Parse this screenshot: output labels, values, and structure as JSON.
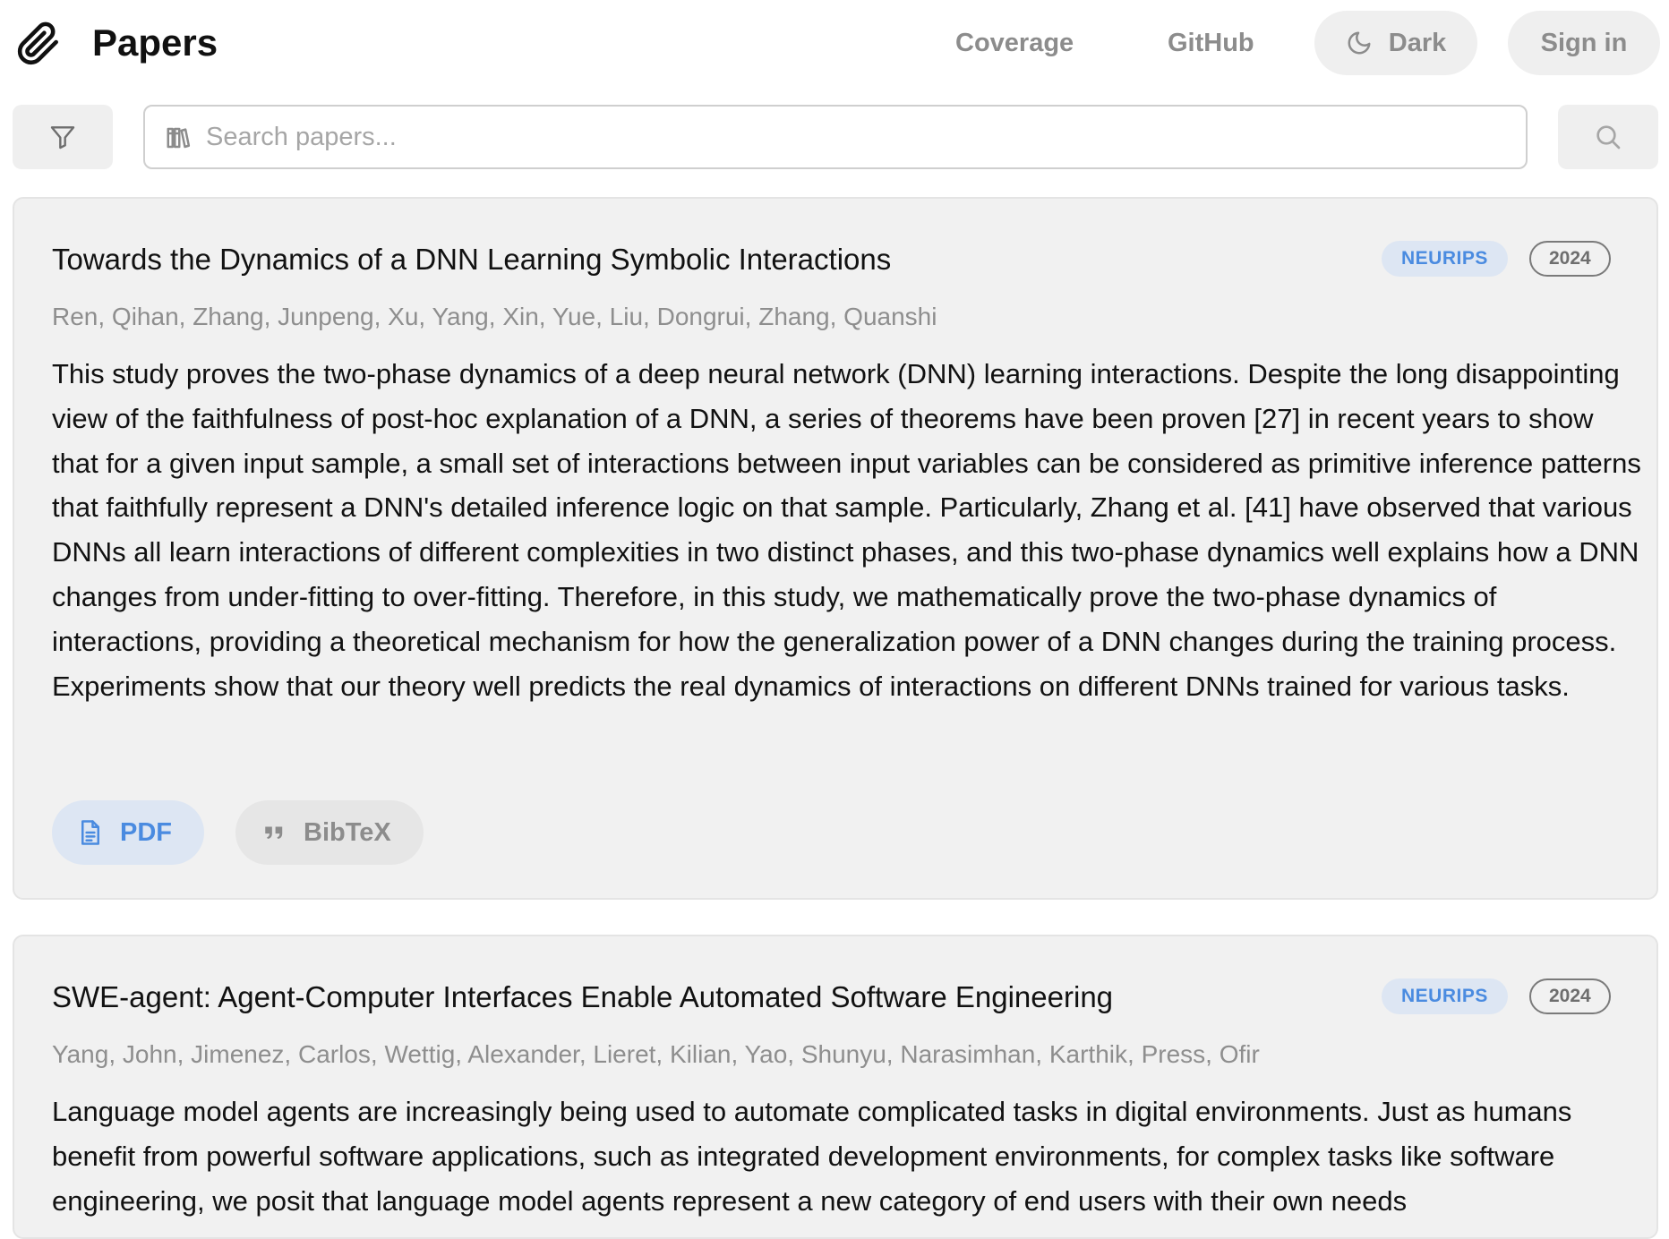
{
  "header": {
    "brand": "Papers",
    "logo_icon": "paperclip-icon",
    "nav": {
      "coverage": "Coverage",
      "github": "GitHub",
      "dark": "Dark",
      "sign_in": "Sign in"
    }
  },
  "search": {
    "placeholder": "Search papers...",
    "value": ""
  },
  "papers": [
    {
      "title": "Towards the Dynamics of a DNN Learning Symbolic Interactions",
      "venue": "NEURIPS",
      "year": "2024",
      "authors": "Ren, Qihan, Zhang, Junpeng, Xu, Yang, Xin, Yue, Liu, Dongrui, Zhang, Quanshi",
      "abstract": "This study proves the two-phase dynamics of a deep neural network (DNN) learning interactions. Despite the long disappointing view of the faithfulness of post-hoc explanation of a DNN, a series of theorems have been proven [27] in recent years to show that for a given input sample, a small set of interactions between input variables can be considered as primitive inference patterns that faithfully represent a DNN's detailed inference logic on that sample. Particularly, Zhang et al. [41] have observed that various DNNs all learn interactions of different complexities in two distinct phases, and this two-phase dynamics well explains how a DNN changes from under-fitting to over-fitting. Therefore, in this study, we mathematically prove the two-phase dynamics of interactions, providing a theoretical mechanism for how the generalization power of a DNN changes during the training process. Experiments show that our theory well predicts the real dynamics of interactions on different DNNs trained for various tasks.",
      "pdf_label": "PDF",
      "bibtex_label": "BibTeX"
    },
    {
      "title": "SWE-agent: Agent-Computer Interfaces Enable Automated Software Engineering",
      "venue": "NEURIPS",
      "year": "2024",
      "authors": "Yang, John, Jimenez, Carlos, Wettig, Alexander, Lieret, Kilian, Yao, Shunyu, Narasimhan, Karthik, Press, Ofir",
      "abstract": "Language model agents are increasingly being used to automate complicated tasks in digital environments. Just as humans benefit from powerful software applications, such as integrated development environments, for complex tasks like software engineering, we posit that language model agents represent a new category of end users with their own needs"
    }
  ],
  "colors": {
    "accent": "#4a8be0",
    "accent_bg": "#dde6f3",
    "card_bg": "#f1f1f1",
    "muted_text": "#8c8c8c"
  }
}
